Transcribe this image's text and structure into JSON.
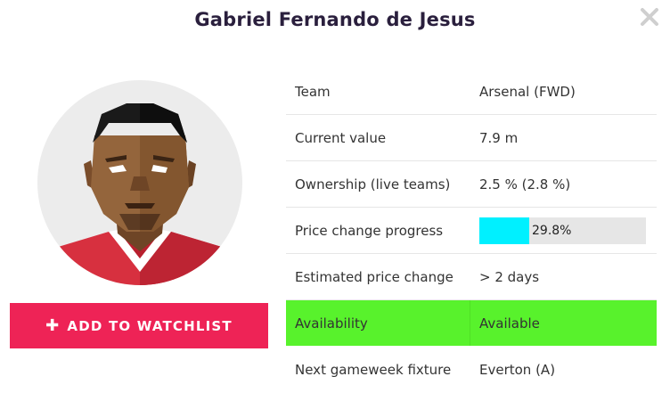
{
  "player": {
    "name": "Gabriel Fernando de Jesus"
  },
  "actions": {
    "watchlist_label": "ADD TO WATCHLIST",
    "watchlist_icon": "plus-icon"
  },
  "close_icon": "close-icon",
  "details": [
    {
      "label": "Team",
      "value": "Arsenal (FWD)"
    },
    {
      "label": "Current value",
      "value": "7.9 m"
    },
    {
      "label": "Ownership (live teams)",
      "value": "2.5 % (2.8 %)"
    },
    {
      "label": "Price change progress",
      "value": "29.8%",
      "progress": 29.8
    },
    {
      "label": "Estimated price change",
      "value": "> 2 days"
    },
    {
      "label": "Availability",
      "value": "Available",
      "highlight": "#58f22c"
    },
    {
      "label": "Next gameweek fixture",
      "value": "Everton (A)"
    }
  ],
  "colors": {
    "accent": "#ee2356",
    "progress_fill": "#00f0ff",
    "available": "#58f22c"
  }
}
